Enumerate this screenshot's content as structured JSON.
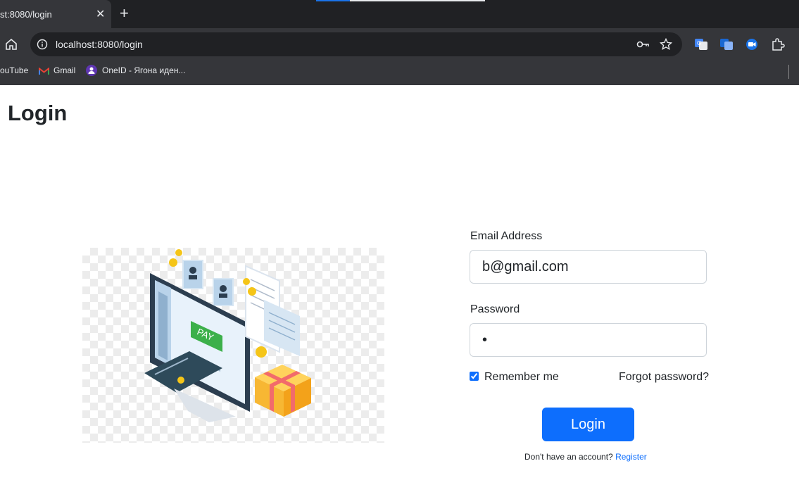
{
  "browser": {
    "tab_title": "st:8080/login",
    "tab_close": "✕",
    "new_tab": "+",
    "url": "localhost:8080/login",
    "bookmarks": [
      {
        "label": "ouTube"
      },
      {
        "label": "Gmail"
      },
      {
        "label": "OneID - Ягона иден..."
      }
    ]
  },
  "page": {
    "title": "Login",
    "illustration_label": "PAY"
  },
  "form": {
    "email_label": "Email Address",
    "email_value": "b@gmail.com",
    "password_label": "Password",
    "password_value": "•",
    "remember_label": "Remember me",
    "remember_checked": true,
    "forgot_label": "Forgot password?",
    "login_button": "Login",
    "register_prompt": "Don't have an account?",
    "register_link": "Register"
  },
  "colors": {
    "primary": "#0d6efd",
    "chrome_dark": "#202124",
    "chrome_mid": "#35363a"
  }
}
